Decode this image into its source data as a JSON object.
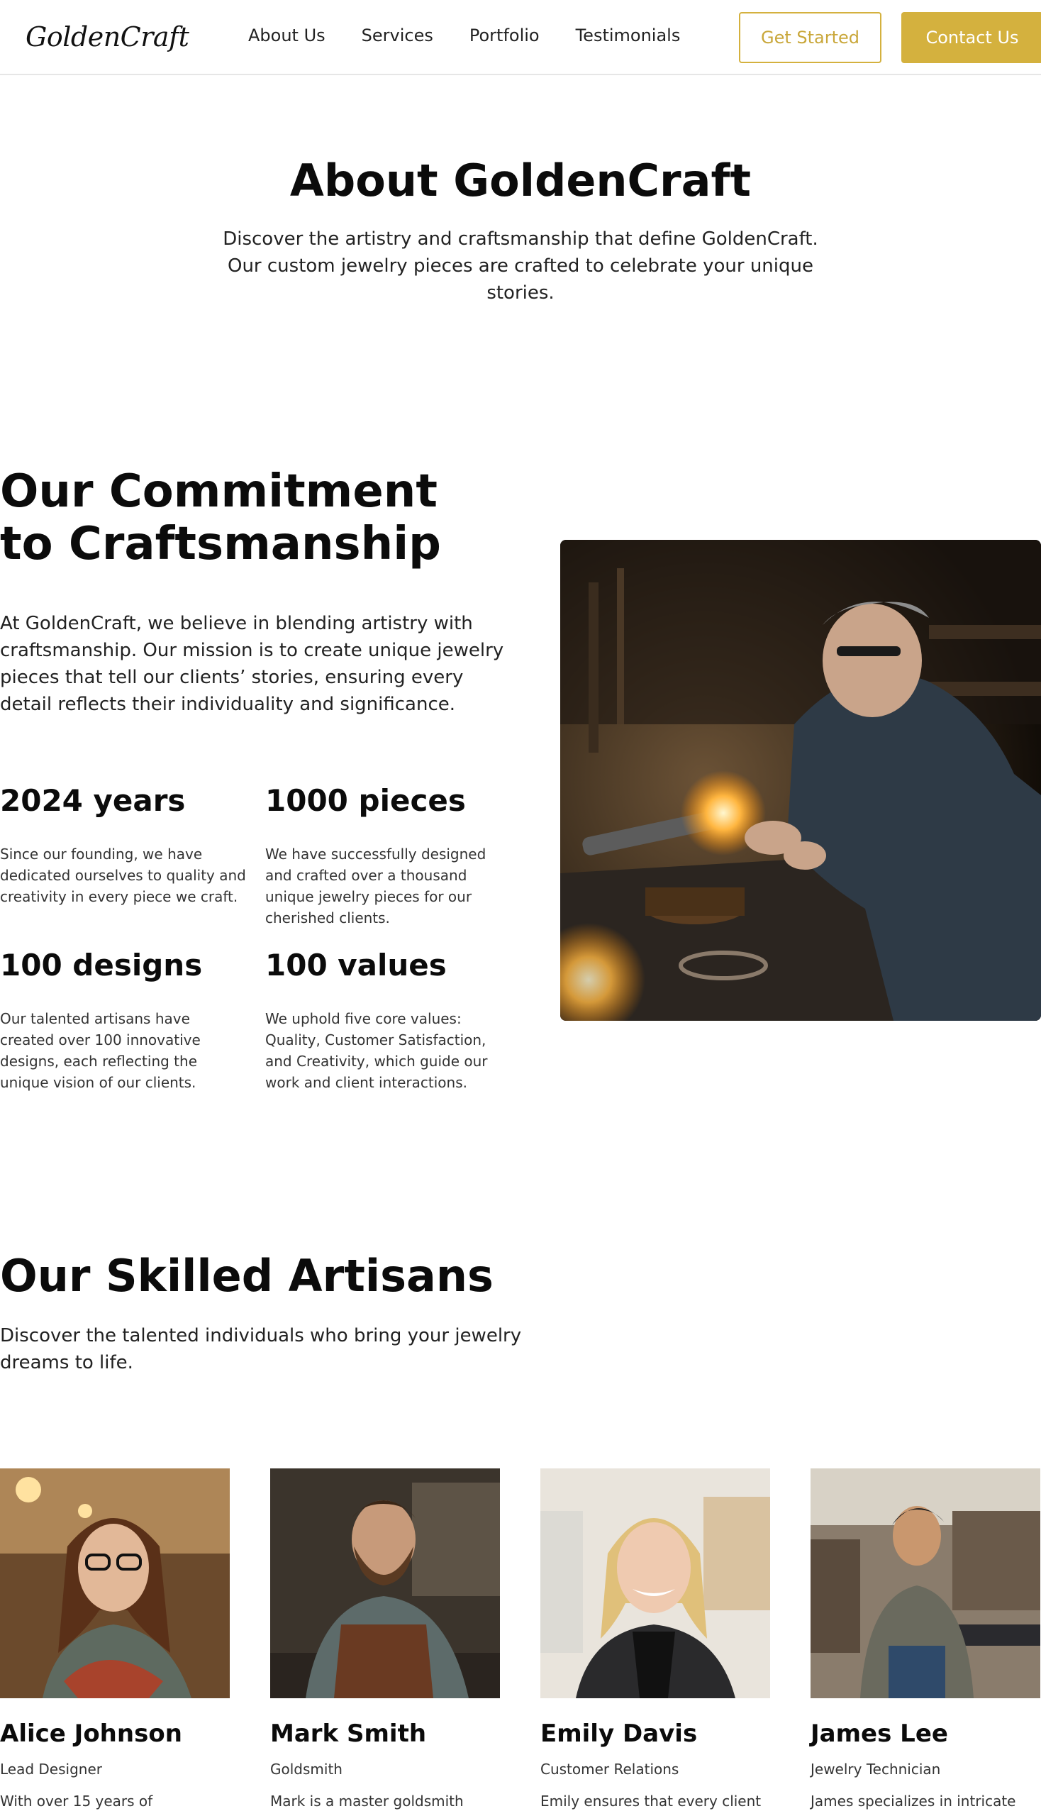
{
  "header": {
    "logo": "GoldenCraft",
    "nav": [
      "About Us",
      "Services",
      "Portfolio",
      "Testimonials"
    ],
    "get_started": "Get Started",
    "contact": "Contact Us"
  },
  "about": {
    "title": "About GoldenCraft",
    "subtitle": "Discover the artistry and craftsmanship that define GoldenCraft. Our custom jewelry pieces are crafted to celebrate your unique stories."
  },
  "commitment": {
    "title": "Our Commitment to Craftsmanship",
    "text": "At GoldenCraft, we believe in blending artistry with craftsmanship. Our mission is to create unique jewelry pieces that tell our clients’ stories, ensuring every detail reflects their individuality and significance.",
    "stats": [
      {
        "value": "2024 years",
        "text": "Since our founding, we have dedicated ourselves to quality and creativity in every piece we craft."
      },
      {
        "value": "1000 pieces",
        "text": "We have successfully designed and crafted over a thousand unique jewelry pieces for our cherished clients."
      },
      {
        "value": "100 designs",
        "text": "Our talented artisans have created over 100 innovative designs, each reflecting the unique vision of our clients."
      },
      {
        "value": "100 values",
        "text": "We uphold five core values: Quality, Customer Satisfaction, and Creativity, which guide our work and client interactions."
      }
    ]
  },
  "artisans": {
    "title": "Our Skilled Artisans",
    "subtitle": "Discover the talented individuals who bring your jewelry dreams to life.",
    "members": [
      {
        "name": "Alice Johnson",
        "role": "Lead Designer",
        "bio": "With over 15 years of experience"
      },
      {
        "name": "Mark Smith",
        "role": "Goldsmith",
        "bio": "Mark is a master goldsmith"
      },
      {
        "name": "Emily Davis",
        "role": "Customer Relations",
        "bio": "Emily ensures that every client"
      },
      {
        "name": "James Lee",
        "role": "Jewelry Technician",
        "bio": "James specializes in intricate"
      }
    ]
  },
  "colors": {
    "accent": "#d4b13e",
    "text": "#111111"
  }
}
